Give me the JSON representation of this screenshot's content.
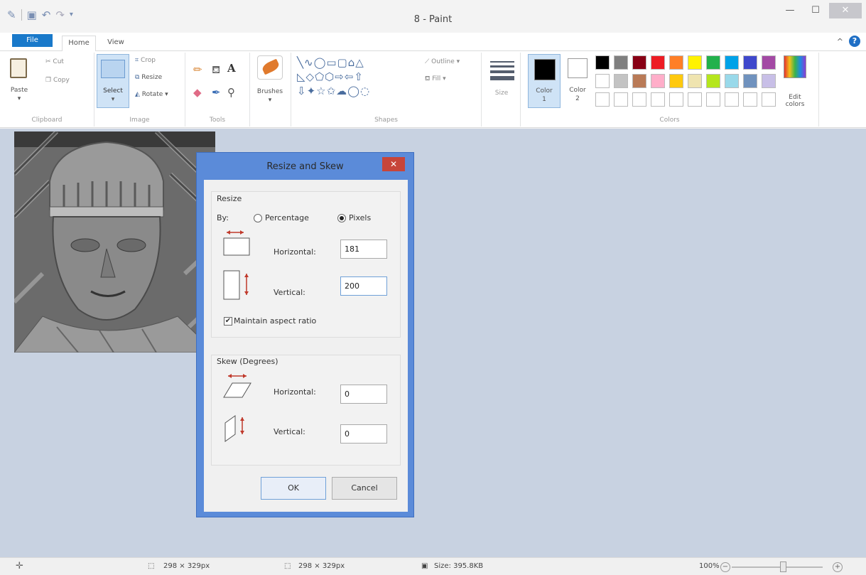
{
  "window": {
    "title": "8 - Paint"
  },
  "tabs": {
    "file": "File",
    "home": "Home",
    "view": "View"
  },
  "ribbon": {
    "clipboard": {
      "paste": "Paste",
      "cut": "Cut",
      "copy": "Copy",
      "label": "Clipboard"
    },
    "image": {
      "select": "Select",
      "crop": "Crop",
      "resize": "Resize",
      "rotate": "Rotate",
      "label": "Image"
    },
    "tools": {
      "label": "Tools"
    },
    "brushes": {
      "label": "Brushes"
    },
    "shapes": {
      "outline": "Outline",
      "fill": "Fill",
      "label": "Shapes"
    },
    "size": {
      "label": "Size"
    },
    "colors": {
      "color1": "Color",
      "color1_num": "1",
      "color2": "Color",
      "color2_num": "2",
      "edit": "Edit",
      "edit2": "colors",
      "label": "Colors",
      "palette_row1": [
        "#000000",
        "#7f7f7f",
        "#880015",
        "#ed1c24",
        "#ff7f27",
        "#fff200",
        "#22b14c",
        "#00a2e8",
        "#3f48cc",
        "#a349a4"
      ],
      "palette_row2": [
        "#ffffff",
        "#c3c3c3",
        "#b97a57",
        "#ffaec9",
        "#ffc90e",
        "#efe4b0",
        "#b5e61d",
        "#99d9ea",
        "#7092be",
        "#c8bfe7"
      ]
    }
  },
  "dialog": {
    "title": "Resize and Skew",
    "resize": {
      "legend": "Resize",
      "by": "By:",
      "percentage": "Percentage",
      "pixels": "Pixels",
      "horizontal_label": "Horizontal:",
      "horizontal_value": "181",
      "vertical_label": "Vertical:",
      "vertical_value": "200",
      "maintain": "Maintain aspect ratio"
    },
    "skew": {
      "legend": "Skew (Degrees)",
      "horizontal_label": "Horizontal:",
      "horizontal_value": "0",
      "vertical_label": "Vertical:",
      "vertical_value": "0"
    },
    "ok": "OK",
    "cancel": "Cancel"
  },
  "status": {
    "selection_size": "298 × 329px",
    "image_size": "298 × 329px",
    "file_size": "Size: 395.8KB",
    "zoom": "100%"
  }
}
